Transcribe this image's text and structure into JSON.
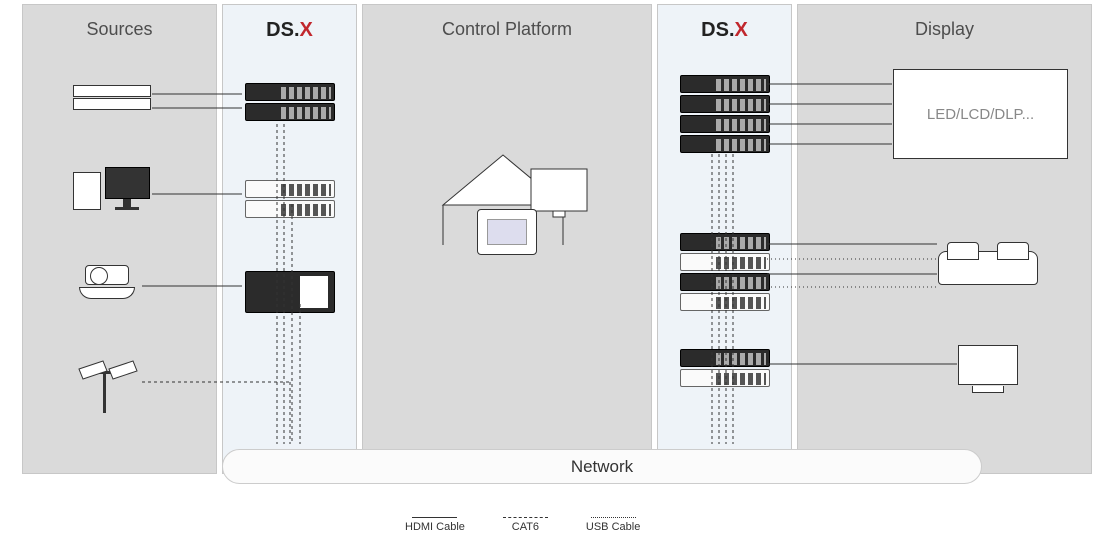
{
  "columns": {
    "sources": "Sources",
    "dsx_left": {
      "prefix": "DS.",
      "suffix": "X"
    },
    "control": "Control Platform",
    "dsx_right": {
      "prefix": "DS.",
      "suffix": "X"
    },
    "display": "Display"
  },
  "sources": {
    "rack_server": "rack-server",
    "pc": "workstation-pc",
    "ptz_camera": "ptz-camera",
    "cctv_camera": "cctv-camera"
  },
  "control_platform": {
    "table": "control-desk",
    "monitor": "secondary-monitor",
    "tablet": "touch-panel"
  },
  "displays": {
    "videowall_label": "LED/LCD/DLP...",
    "operator_console": "operator-console",
    "single_monitor": "single-monitor"
  },
  "legend": {
    "hdmi": "HDMI Cable",
    "cat6": "CAT6",
    "usb": "USB Cable"
  },
  "network_label": "Network"
}
